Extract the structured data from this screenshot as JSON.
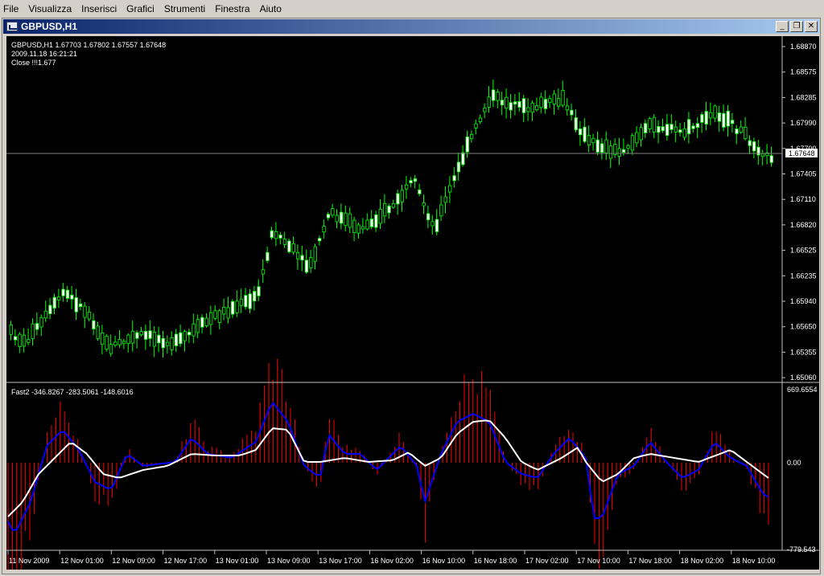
{
  "menu": [
    "File",
    "Visualizza",
    "Inserisci",
    "Grafici",
    "Strumenti",
    "Finestra",
    "Aiuto"
  ],
  "window": {
    "title": "GBPUSD,H1",
    "buttons": {
      "minimize": "_",
      "restore": "❐",
      "close": "✕"
    }
  },
  "price_panel": {
    "info_line1": "GBPUSD,H1  1.67703 1.67802 1.67557 1.67648",
    "info_line2": "2009.11.18 16:21:21",
    "info_line3": "Close !!!1.677",
    "current_price": "1.67648",
    "axis_labels": [
      "1.68870",
      "1.68575",
      "1.68285",
      "1.67990",
      "1.67700",
      "1.67405",
      "1.67110",
      "1.66820",
      "1.66525",
      "1.66235",
      "1.65940",
      "1.65650",
      "1.65355",
      "1.65060"
    ]
  },
  "indicator_panel": {
    "label": "Fast2 -346.8267 -283.5061 -148.6016",
    "axis_labels": [
      "669.6554",
      "0.00",
      "-779.543"
    ]
  },
  "time_axis": [
    "11 Nov 2009",
    "12 Nov 01:00",
    "12 Nov 09:00",
    "12 Nov 17:00",
    "13 Nov 01:00",
    "13 Nov 09:00",
    "13 Nov 17:00",
    "16 Nov 02:00",
    "16 Nov 10:00",
    "16 Nov 18:00",
    "17 Nov 02:00",
    "17 Nov 10:00",
    "17 Nov 18:00",
    "18 Nov 02:00",
    "18 Nov 10:00"
  ],
  "colors": {
    "background": "#000000",
    "candle_up": "#00ff00",
    "candle_down": "#ffffff",
    "histogram": "#ff0000",
    "fast_line": "#0000ff",
    "slow_line": "#ffffff",
    "title_start": "#0a246a",
    "title_end": "#a6caf0"
  }
}
